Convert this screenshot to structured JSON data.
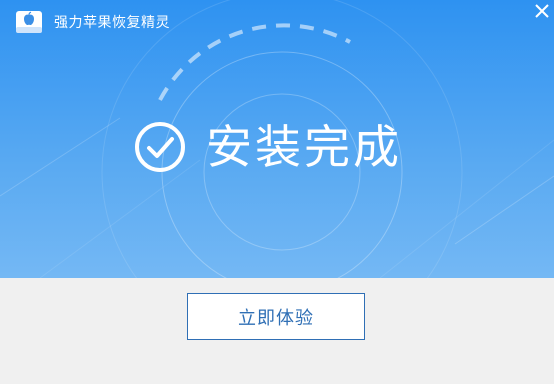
{
  "window": {
    "title": "强力苹果恢复精灵",
    "icons": {
      "app": "apple-disk-icon",
      "close": "close-icon"
    }
  },
  "status": {
    "icon": "check-circle-icon",
    "text": "安装完成"
  },
  "footer": {
    "primary_button_label": "立即体验"
  },
  "colors": {
    "hero_top": "#2e92f1",
    "hero_bottom": "#74b8f4",
    "footer_bg": "#f0f0f0",
    "button_border": "#2f6fb5",
    "button_text": "#2f6fb5"
  }
}
